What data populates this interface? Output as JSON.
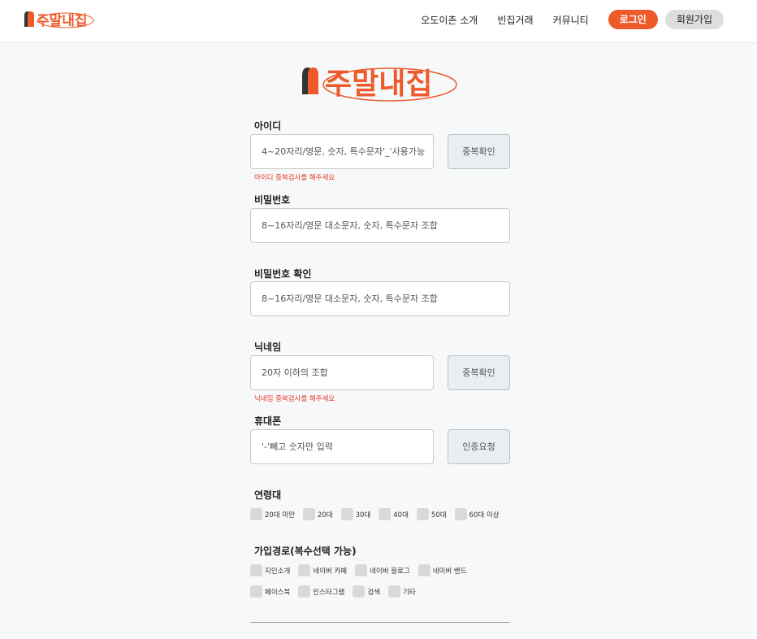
{
  "brand": {
    "logo_text": "주말내집",
    "accent": "#ee5a2b"
  },
  "nav": {
    "links": [
      "오도이촌 소개",
      "빈집거래",
      "커뮤니티"
    ],
    "login": "로그인",
    "join": "회원가입"
  },
  "form": {
    "id": {
      "label": "아이디",
      "placeholder": "4~20자리/영문, 숫자, 특수문자'_'사용가능",
      "button": "중복확인",
      "error": "아이디 중복검사를 해주세요"
    },
    "password": {
      "label": "비밀번호",
      "placeholder": "8~16자리/영문 대소문자, 숫자, 특수문자 조합"
    },
    "password_confirm": {
      "label": "비밀번호 확인",
      "placeholder": "8~16자리/영문 대소문자, 숫자, 특수문자 조합"
    },
    "nickname": {
      "label": "닉네임",
      "placeholder": "20자 이하의 조합",
      "button": "중복확인",
      "error": "닉네임 중복검사를 해주세요"
    },
    "phone": {
      "label": "휴대폰",
      "placeholder": "'-'빼고 숫자만 입력",
      "button": "인증요청"
    },
    "age": {
      "label": "연령대",
      "options": [
        "20대 미만",
        "20대",
        "30대",
        "40대",
        "50대",
        "60대 이상"
      ]
    },
    "source": {
      "label": "가입경로(복수선택 가능)",
      "options_row1": [
        "지인소개",
        "네이버 카페",
        "네이버 블로그",
        "네이버 밴드"
      ],
      "options_row2": [
        "페이스북",
        "인스타그램",
        "검색",
        "기타"
      ]
    }
  }
}
